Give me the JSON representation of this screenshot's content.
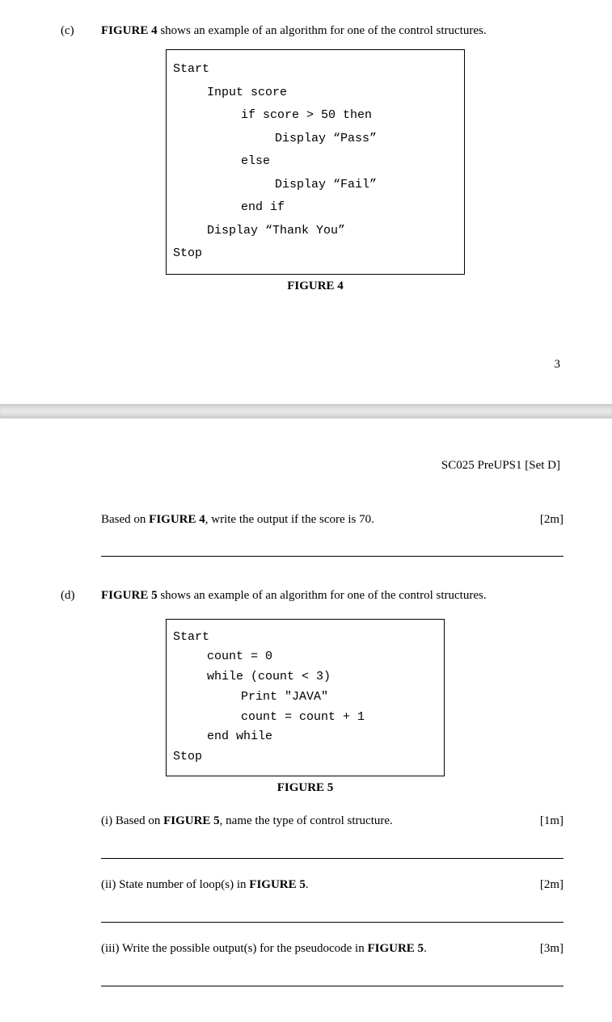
{
  "page1": {
    "qc": {
      "label": "(c)",
      "intro_prefix": "FIGURE 4",
      "intro_rest": " shows an example of an algorithm for one of the control structures.",
      "code": {
        "l1": "Start",
        "l2": "Input score",
        "l3": "if score > 50 then",
        "l4": "Display “Pass”",
        "l5": "else",
        "l6": "Display “Fail”",
        "l7": "end if",
        "l8": "Display “Thank You”",
        "l9": "Stop"
      },
      "caption": "FIGURE 4"
    },
    "page_number": "3"
  },
  "page2": {
    "header": "SC025 PreUPS1 [Set D]",
    "qc_cont": {
      "text_prefix": "Based on ",
      "text_bold": "FIGURE 4",
      "text_rest": ", write the output if the score is 70.",
      "marks": "[2m]"
    },
    "qd": {
      "label": "(d)",
      "intro_prefix": "FIGURE 5",
      "intro_rest": " shows an example of an algorithm for one of the control structures.",
      "code": {
        "l1": "Start",
        "l2": "count = 0",
        "l3": "while (count < 3)",
        "l4": "Print \"JAVA\"",
        "l5": "count = count + 1",
        "l6": "end while",
        "l7": "Stop"
      },
      "caption": "FIGURE 5",
      "sub": {
        "i": {
          "prefix": "(i) Based on ",
          "bold": "FIGURE 5",
          "rest": ", name the type of control structure.",
          "marks": "[1m]"
        },
        "ii": {
          "prefix": "(ii) State number of loop(s) in ",
          "bold": "FIGURE 5",
          "rest": ".",
          "marks": "[2m]"
        },
        "iii": {
          "prefix": "(iii) Write the possible output(s) for the pseudocode in ",
          "bold": "FIGURE 5",
          "rest": ".",
          "marks": "[3m]"
        }
      }
    }
  }
}
